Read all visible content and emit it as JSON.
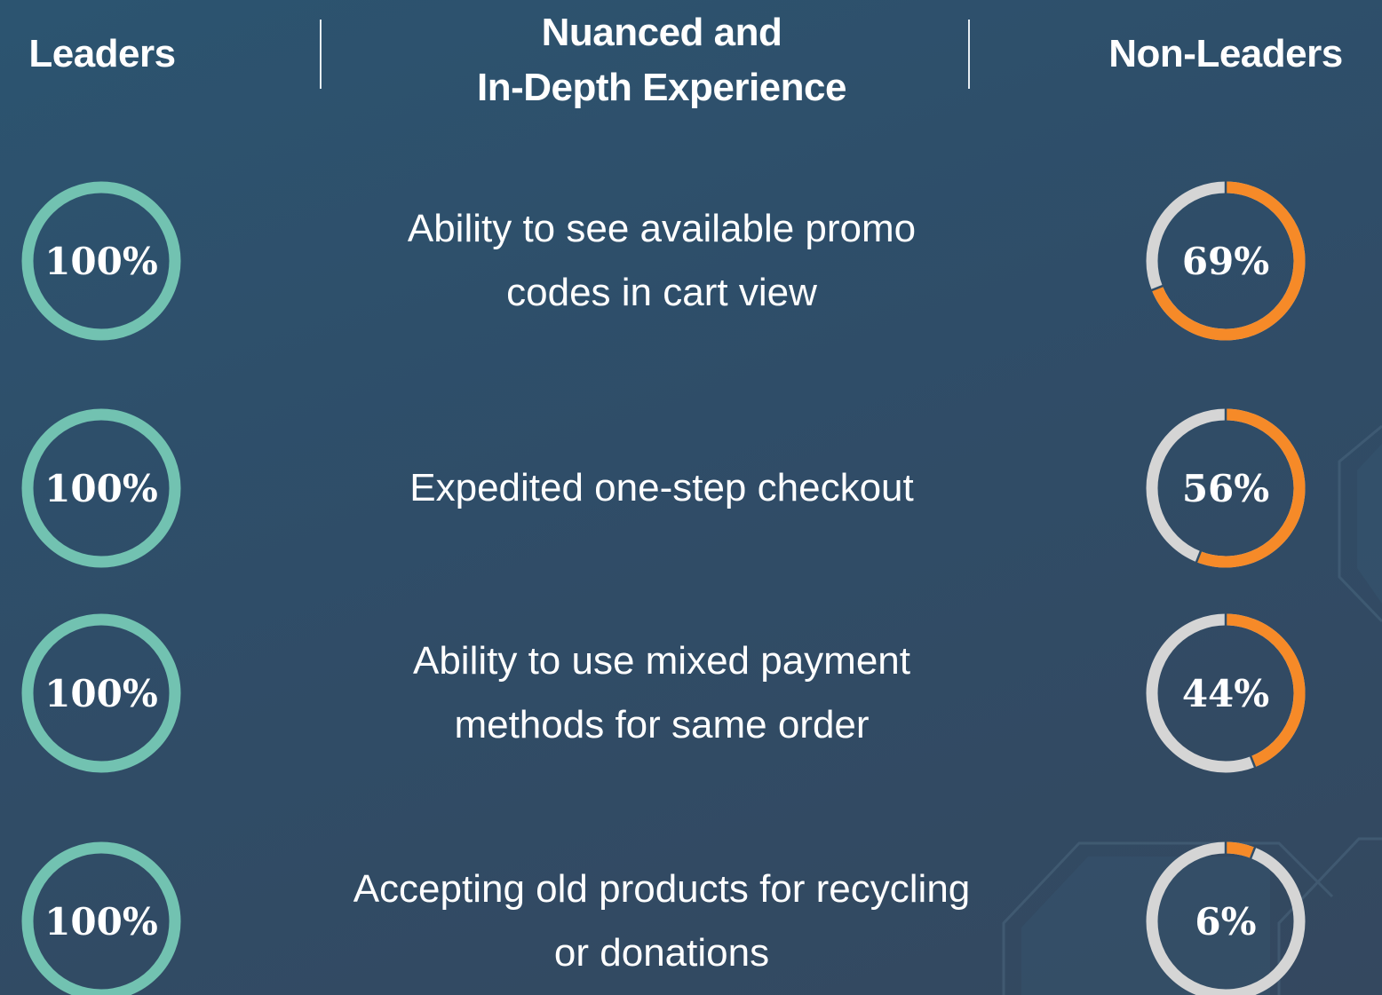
{
  "header": {
    "leaders": "Leaders",
    "feature": "Nuanced and\nIn-Depth Experience",
    "non_leaders": "Non-Leaders"
  },
  "colors": {
    "leaders_ring": "#72c2b1",
    "non_leaders_fill": "#f68a28",
    "track": "#d5d5d5",
    "text": "#ffffff"
  },
  "chart_data": {
    "type": "donut",
    "categories": [
      "Ability to see available promo\ncodes in cart view",
      "Expedited one-step checkout",
      "Ability to use mixed payment\nmethods for same order",
      "Accepting old products for recycling\nor donations"
    ],
    "series": [
      {
        "name": "Leaders",
        "values": [
          100,
          100,
          100,
          100
        ],
        "labels": [
          "100%",
          "100%",
          "100%",
          "100%"
        ]
      },
      {
        "name": "Non-Leaders",
        "values": [
          69,
          56,
          44,
          6
        ],
        "labels": [
          "69%",
          "56%",
          "44%",
          "6%"
        ]
      }
    ]
  }
}
